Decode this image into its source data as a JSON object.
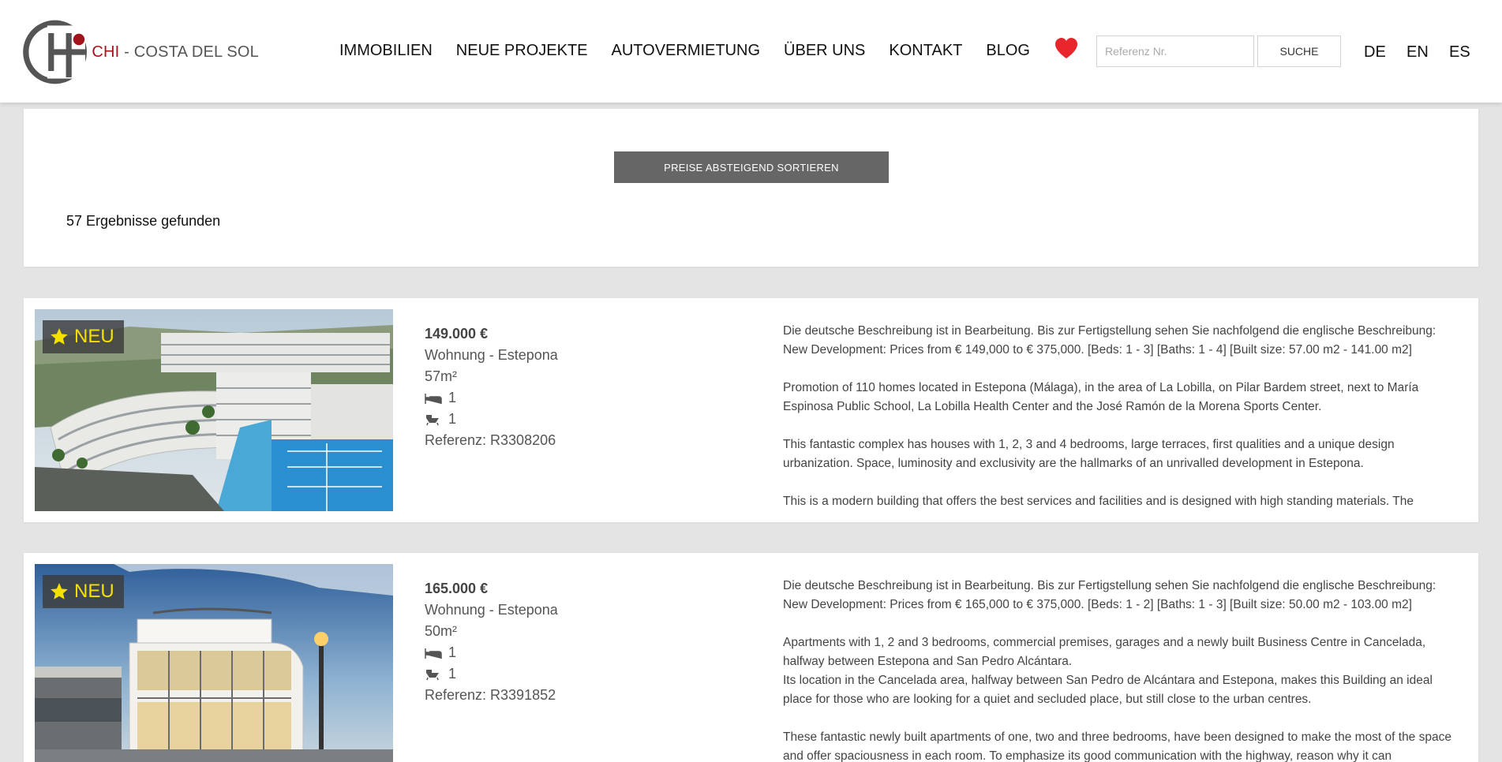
{
  "header": {
    "logo_brand": "CHI",
    "logo_separator": " - ",
    "logo_region": "COSTA DEL SOL",
    "nav": [
      "IMMOBILIEN",
      "NEUE PROJEKTE",
      "AUTOVERMIETUNG",
      "ÜBER UNS",
      "KONTAKT",
      "BLOG"
    ],
    "favorites_icon": "heart-icon",
    "search_placeholder": "Referenz Nr.",
    "search_button": "SUCHE",
    "languages": [
      "DE",
      "EN",
      "ES"
    ]
  },
  "filter": {
    "sort_button": "PREISE ABSTEIGEND SORTIEREN",
    "results_count": "57 Ergebnisse gefunden"
  },
  "listings": [
    {
      "badge": "NEU",
      "price": "149.000 €",
      "type_location": "Wohnung - Estepona",
      "size": "57m²",
      "bedrooms": "1",
      "bathrooms": "1",
      "reference": "Referenz: R3308206",
      "description": [
        "Die deutsche Beschreibung ist in Bearbeitung. Bis zur Fertigstellung sehen Sie nachfolgend die englische Beschreibung: New Development: Prices from € 149,000 to € 375,000. [Beds: 1 - 3] [Baths: 1 - 4] [Built size: 57.00 m2 - 141.00 m2]",
        "Promotion of 110 homes located in Estepona (Málaga), in the area of La Lobilla, on Pilar Bardem street, next to María Espinosa Public School, La Lobilla Health Center and the José Ramón de la Morena Sports Center.",
        "This fantastic complex has houses with 1, 2, 3 and 4 bedrooms, large terraces, first qualities and a unique design urbanization. Space, luminosity and exclusivity are the hallmarks of an unrivalled development in Estepona.",
        "This is a modern building that offers the best services and facilities and is designed with high standing materials. The"
      ]
    },
    {
      "badge": "NEU",
      "price": "165.000 €",
      "type_location": "Wohnung - Estepona",
      "size": "50m²",
      "bedrooms": "1",
      "bathrooms": "1",
      "reference": "Referenz: R3391852",
      "description": [
        "Die deutsche Beschreibung ist in Bearbeitung. Bis zur Fertigstellung sehen Sie nachfolgend die englische Beschreibung: New Development: Prices from € 165,000 to € 375,000. [Beds: 1 - 2] [Baths: 1 - 3] [Built size: 50.00 m2 - 103.00 m2]",
        "Apartments with 1, 2 and 3 bedrooms, commercial premises, garages and a newly built Business Centre in Cancelada, halfway between Estepona and San Pedro Alcántara.",
        "Its location in the Cancelada area, halfway between San Pedro de Alcántara and Estepona, makes this Building an ideal place for those who are looking for a quiet and secluded place, but still close to the urban centres.",
        "These fantastic newly built apartments of one, two and three bedrooms, have been designed to make the most of the space and offer spaciousness in each room. To emphasize its good communication with the highway, reason why it can"
      ]
    }
  ],
  "colors": {
    "brand_red": "#a2141a",
    "heart_red": "#e8262b",
    "badge_star_yellow": "#f5e100",
    "sort_button_bg": "#666666",
    "page_bg": "#e4e4e4"
  }
}
